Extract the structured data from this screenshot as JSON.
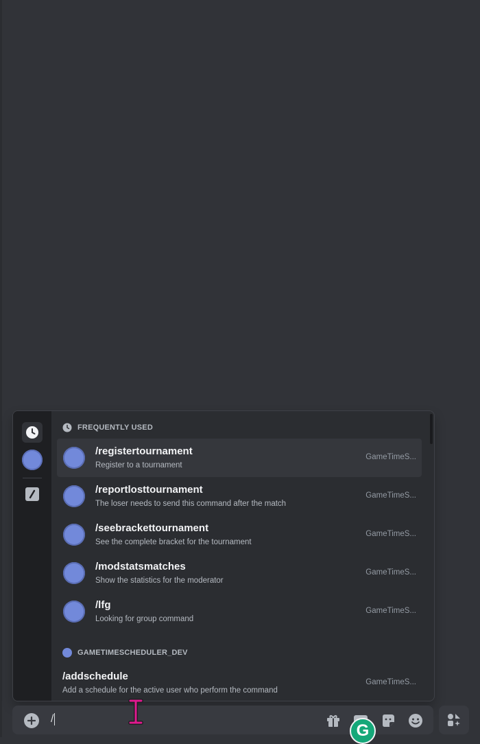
{
  "autocomplete": {
    "frequently_used_header": "FREQUENTLY USED",
    "frequent_commands": [
      {
        "name": "/registertournament",
        "description": "Register to a tournament",
        "source": "GameTimeS...",
        "selected": true
      },
      {
        "name": "/reportlosttournament",
        "description": "The loser needs to send this command after the match",
        "source": "GameTimeS..."
      },
      {
        "name": "/seebrackettournament",
        "description": "See the complete bracket for the tournament",
        "source": "GameTimeS..."
      },
      {
        "name": "/modstatsmatches",
        "description": "Show the statistics for the moderator",
        "source": "GameTimeS..."
      },
      {
        "name": "/lfg",
        "description": "Looking for group command",
        "source": "GameTimeS..."
      }
    ],
    "app_section_header": "GAMETIMESCHEDULER_DEV",
    "app_commands": [
      {
        "name": "/addschedule",
        "description": "Add a schedule for the active user who perform the command",
        "source": "GameTimeS..."
      }
    ],
    "rail": {
      "icons": [
        "clock-icon",
        "app-avatar",
        "slash-command-icon"
      ]
    }
  },
  "message_input": {
    "value": "/",
    "toolbar_icons": [
      "gift-icon",
      "gif-icon",
      "sticker-icon",
      "emoji-icon"
    ]
  },
  "colors": {
    "background": "#313338",
    "popup": "#2b2d31",
    "rail": "#1e1f22",
    "blurple": "#7289da",
    "grammarly": "#15a879"
  }
}
